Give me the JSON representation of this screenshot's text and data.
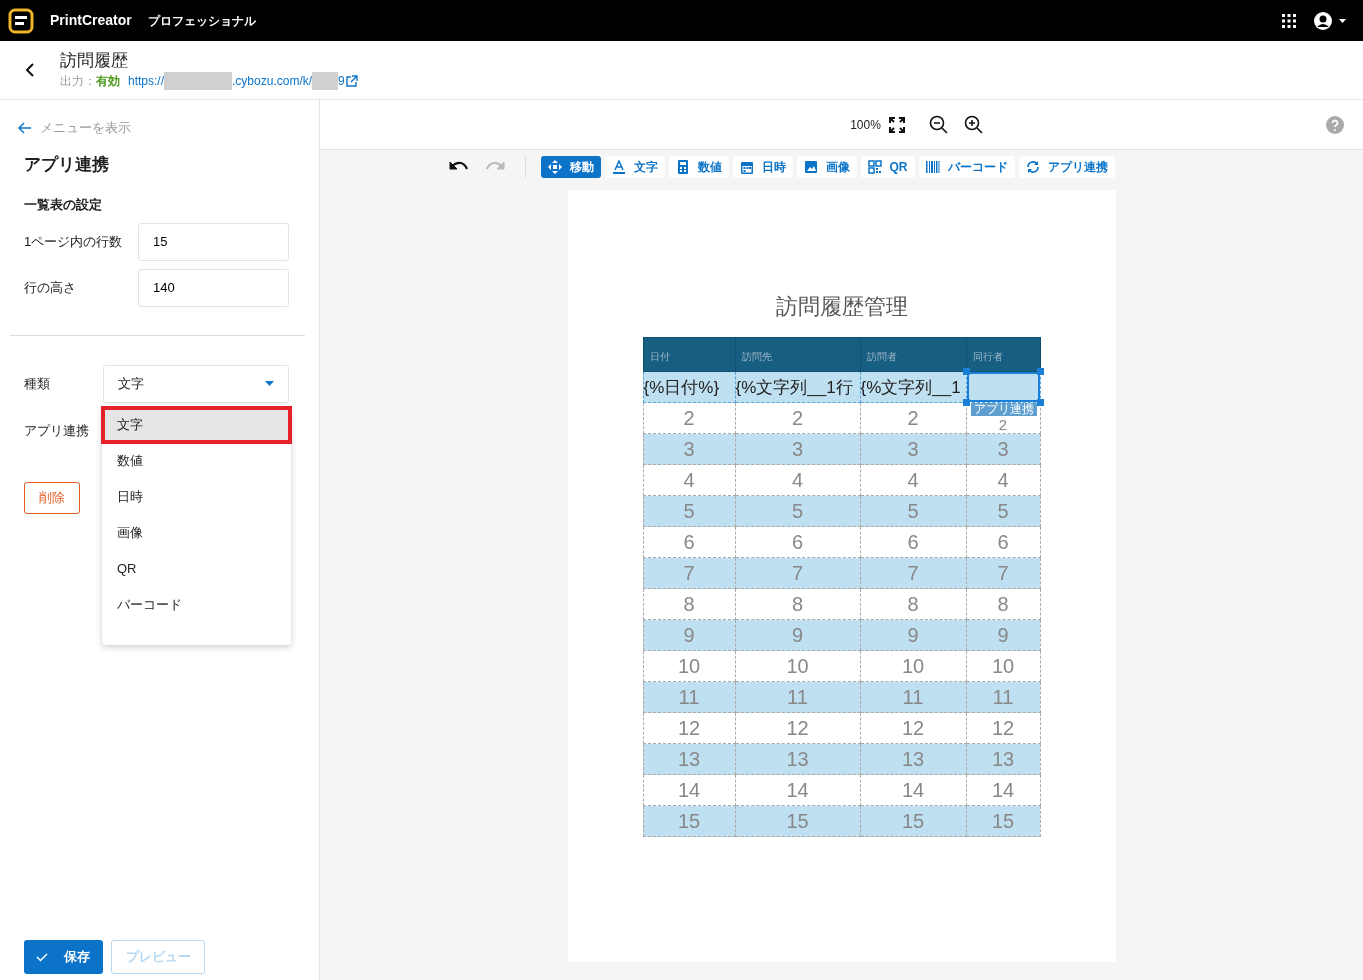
{
  "topbar": {
    "app_name": "PrintCreator",
    "edition": "プロフェッショナル"
  },
  "header": {
    "title": "訪問履歴",
    "output_label": "出力：",
    "output_status": "有効",
    "url_parts": [
      "https://",
      ".cybozu.com/k/",
      "9"
    ]
  },
  "sidebar": {
    "menu_link": "メニューを表示",
    "heading": "アプリ連携",
    "section": "一覧表の設定",
    "fields": [
      {
        "label": "1ページ内の行数",
        "value": "15"
      },
      {
        "label": "行の高さ",
        "value": "140"
      }
    ],
    "type_label": "種類",
    "type_value": "文字",
    "link_label": "アプリ連携",
    "delete_button": "削除",
    "dropdown": [
      {
        "label": "文字",
        "selected": true
      },
      {
        "label": "数値",
        "selected": false
      },
      {
        "label": "日時",
        "selected": false
      },
      {
        "label": "画像",
        "selected": false
      },
      {
        "label": "QR",
        "selected": false
      },
      {
        "label": "バーコード",
        "selected": false
      }
    ],
    "save_button": "保存",
    "preview_button": {
      "label": "プレビュー",
      "disabled": true
    }
  },
  "zoom": {
    "level_text": "100%"
  },
  "toolbar": {
    "undo_disabled": false,
    "redo_disabled": true,
    "tools": [
      {
        "kind": "move",
        "label": "移動",
        "selected": true
      },
      {
        "kind": "text",
        "label": "文字",
        "selected": false
      },
      {
        "kind": "number",
        "label": "数値",
        "selected": false
      },
      {
        "kind": "date",
        "label": "日時",
        "selected": false
      },
      {
        "kind": "image",
        "label": "画像",
        "selected": false
      },
      {
        "kind": "qr",
        "label": "QR",
        "selected": false
      },
      {
        "kind": "barcode",
        "label": "バーコード",
        "selected": false
      },
      {
        "kind": "link",
        "label": "アプリ連携",
        "selected": false
      }
    ]
  },
  "document": {
    "title": "訪問履歴管理",
    "columns": [
      "日付",
      "訪問先",
      "訪問者",
      "同行者"
    ],
    "template_row": {
      "cells": [
        "{%日付%}",
        "{%文字列__1行",
        "{%文字列__1"
      ],
      "selected_tag": "アプリ連携"
    },
    "rows": [
      {
        "cells": [
          "2",
          "2",
          "2",
          "2"
        ],
        "shaded": false
      },
      {
        "cells": [
          "3",
          "3",
          "3",
          "3"
        ],
        "shaded": true
      },
      {
        "cells": [
          "4",
          "4",
          "4",
          "4"
        ],
        "shaded": false
      },
      {
        "cells": [
          "5",
          "5",
          "5",
          "5"
        ],
        "shaded": true
      },
      {
        "cells": [
          "6",
          "6",
          "6",
          "6"
        ],
        "shaded": false
      },
      {
        "cells": [
          "7",
          "7",
          "7",
          "7"
        ],
        "shaded": true
      },
      {
        "cells": [
          "8",
          "8",
          "8",
          "8"
        ],
        "shaded": false
      },
      {
        "cells": [
          "9",
          "9",
          "9",
          "9"
        ],
        "shaded": true
      },
      {
        "cells": [
          "10",
          "10",
          "10",
          "10"
        ],
        "shaded": false
      },
      {
        "cells": [
          "11",
          "11",
          "11",
          "11"
        ],
        "shaded": true
      },
      {
        "cells": [
          "12",
          "12",
          "12",
          "12"
        ],
        "shaded": false
      },
      {
        "cells": [
          "13",
          "13",
          "13",
          "13"
        ],
        "shaded": true
      },
      {
        "cells": [
          "14",
          "14",
          "14",
          "14"
        ],
        "shaded": false
      },
      {
        "cells": [
          "15",
          "15",
          "15",
          "15"
        ],
        "shaded": true
      }
    ]
  }
}
